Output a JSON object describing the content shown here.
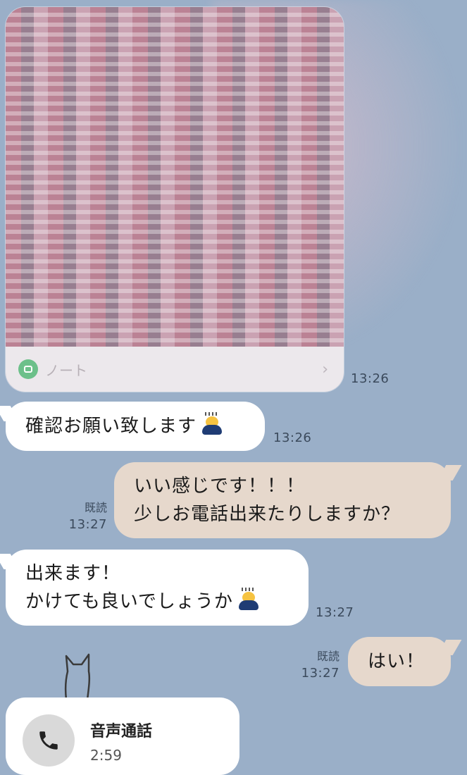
{
  "note": {
    "label": "ノート"
  },
  "messages": [
    {
      "text": "13:26"
    },
    {
      "text": "確認お願い致します",
      "time": "13:26"
    },
    {
      "lines": [
        "いい感じです！！！",
        "少しお電話出来たりしますか？"
      ],
      "read": "既読",
      "time": "13:27"
    },
    {
      "lines": [
        "出来ます！",
        "かけても良いでしょうか"
      ],
      "time": "13:27"
    },
    {
      "text": "はい！",
      "read": "既読",
      "time": "13:27"
    }
  ],
  "call": {
    "title": "音声通話",
    "duration": "2:59"
  },
  "icons": {
    "note": "note-icon",
    "chevron": "chevron-right-icon",
    "emoji": "bowing-person-emoji",
    "phone": "phone-icon",
    "cat": "cat-silhouette-icon"
  }
}
